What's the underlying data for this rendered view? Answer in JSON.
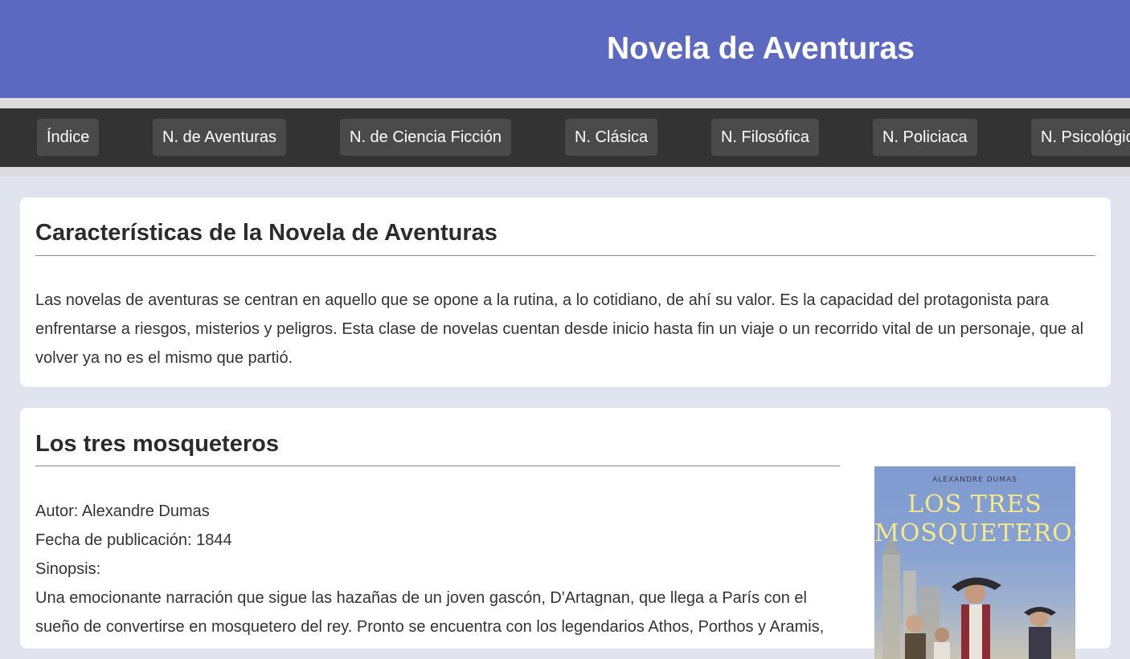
{
  "header": {
    "title": "Novela de Aventuras"
  },
  "nav": {
    "items": [
      {
        "label": "Índice"
      },
      {
        "label": "N. de Aventuras"
      },
      {
        "label": "N. de Ciencia Ficción"
      },
      {
        "label": "N. Clásica"
      },
      {
        "label": "N. Filosófica"
      },
      {
        "label": "N. Policiaca"
      },
      {
        "label": "N. Psicológica"
      }
    ]
  },
  "characteristics": {
    "title": "Características de la Novela de Aventuras",
    "text": "Las novelas de aventuras se centran en aquello que se opone a la rutina, a lo cotidiano, de ahí su valor. Es la capacidad del protagonista para enfrentarse a riesgos, misterios y peligros. Esta clase de novelas cuentan desde inicio hasta fin un viaje o un recorrido vital de un personaje, que al volver ya no es el mismo que partió."
  },
  "book": {
    "title": "Los tres mosqueteros",
    "author_line": "Autor: Alexandre Dumas",
    "date_line": "Fecha de publicación: 1844",
    "synopsis_label": "Sinopsis:",
    "synopsis_line1": "Una emocionante narración que sigue las hazañas de un joven gascón, D'Artagnan, que llega a París con el",
    "synopsis_line2": "sueño de convertirse en mosquetero del rey. Pronto se encuentra con los legendarios Athos, Porthos y Aramis,",
    "cover": {
      "author": "ALEXANDRE DUMAS",
      "title_line1": "LOS TRES",
      "title_line2": "MOSQUETEROS"
    }
  },
  "colors": {
    "header_bg": "#5c69c1",
    "nav_bg": "#333333",
    "nav_item_bg": "#4a4a4a",
    "page_bg": "#e1e4ef"
  }
}
